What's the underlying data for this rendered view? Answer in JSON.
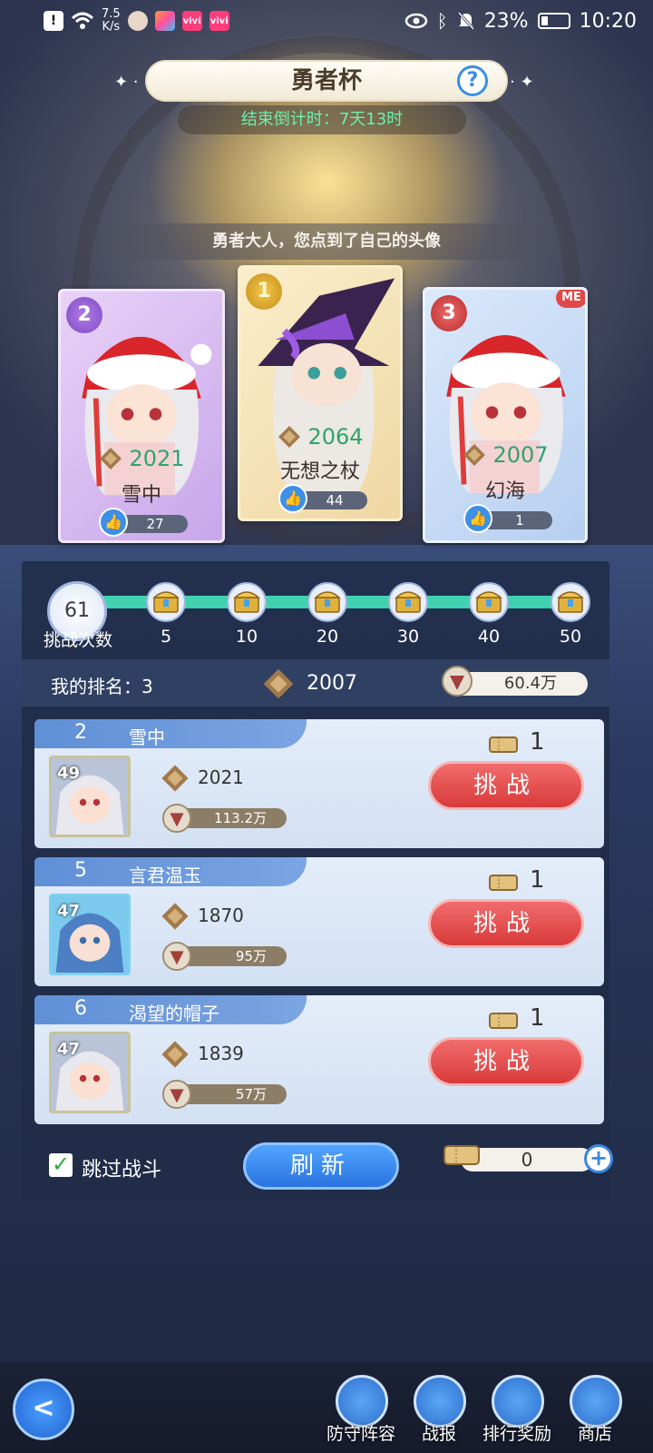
{
  "status_bar": {
    "speed_value": "7.5",
    "speed_unit": "K/s",
    "battery": "23%",
    "time": "10:20",
    "icons": [
      "alert-icon",
      "wifi-icon",
      "avatar-icon",
      "app-icon",
      "vivi-icon",
      "vivi-icon",
      "eye-icon",
      "bluetooth-icon",
      "mute-icon",
      "battery-icon"
    ]
  },
  "header": {
    "title": "勇者杯",
    "help": "?",
    "countdown_label": "结束倒计时：",
    "countdown_value": "7天13时"
  },
  "hint": "勇者大人，您点到了自己的头像",
  "podium": [
    {
      "rank": "2",
      "score": "2021",
      "name": "雪中",
      "likes": "27",
      "me": false
    },
    {
      "rank": "1",
      "score": "2064",
      "name": "无想之杖",
      "likes": "44",
      "me": false
    },
    {
      "rank": "3",
      "score": "2007",
      "name": "幻海",
      "likes": "1",
      "me": true,
      "me_label": "ME"
    }
  ],
  "progress": {
    "challenge_count": "61",
    "challenge_label": "挑战次数",
    "milestones": [
      "5",
      "10",
      "20",
      "30",
      "40",
      "50"
    ]
  },
  "my_rank": {
    "label": "我的排名：3",
    "score": "2007",
    "power": "60.4万"
  },
  "opponents": [
    {
      "rank": "2",
      "name": "雪中",
      "level": "49",
      "score": "2021",
      "power": "113.2万",
      "tickets": "1",
      "button": "挑战"
    },
    {
      "rank": "5",
      "name": "言君温玉",
      "level": "47",
      "score": "1870",
      "power": "95万",
      "tickets": "1",
      "button": "挑战"
    },
    {
      "rank": "6",
      "name": "渴望的帽子",
      "level": "47",
      "score": "1839",
      "power": "57万",
      "tickets": "1",
      "button": "挑战"
    }
  ],
  "controls": {
    "skip_label": "跳过战斗",
    "refresh_label": "刷新",
    "ticket_count": "0",
    "plus": "+"
  },
  "nav": {
    "back": "<",
    "items": [
      "防守阵容",
      "战报",
      "排行奖励",
      "商店"
    ]
  },
  "colors": {
    "score_green": "#2fa36b",
    "challenge_red": "#e04848",
    "refresh_blue": "#3a86e0",
    "progress_teal": "#3fd1b0"
  }
}
